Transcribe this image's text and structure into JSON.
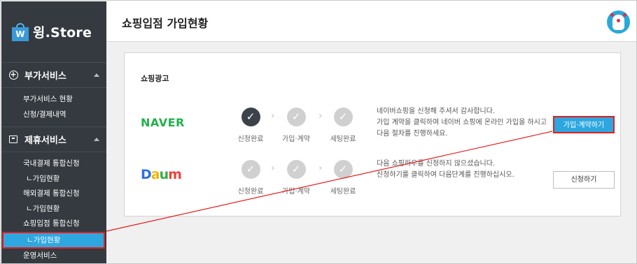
{
  "sidebar": {
    "logo_mark": "W",
    "logo_text": "윙.Store",
    "sections": [
      {
        "title": "부가서비스",
        "icon": "plus-circle-icon",
        "items": [
          "부가서비스 현황",
          "신청/결제내역"
        ]
      },
      {
        "title": "제휴서비스",
        "icon": "box-icon",
        "items": [
          "국내결제 통합신청",
          "ㄴ가입현황",
          "해외결제 통합신청",
          "ㄴ가입현황",
          "쇼핑입점 통합신청",
          "ㄴ가입현황",
          "운영서비스"
        ]
      }
    ]
  },
  "header": {
    "title": "쇼핑입점 가입현황"
  },
  "card": {
    "title": "쇼핑광고",
    "rows": [
      {
        "logo": "NAVER",
        "steps": [
          "신청완료",
          "가입·계약",
          "세팅완료"
        ],
        "desc_line1": "네이버쇼핑을 신청해 주셔서 감사합니다.",
        "desc_line2": "가입 계약을 클릭하여 네이버 쇼핑에 온라인 가입을 하시고 다음 절차를 진행하세요.",
        "button": "가입·계약하기"
      },
      {
        "logo_parts": [
          "D",
          "a",
          "u",
          "m"
        ],
        "steps": [
          "신청완료",
          "가입·계약",
          "세팅완료"
        ],
        "desc_line1": "다음 쇼핑하우를 신청하지 않으셨습니다.",
        "desc_line2": "신청하기를 클릭하여 다음단계를 진행하십시오.",
        "button": "신청하기"
      }
    ]
  },
  "colors": {
    "sidebar_bg": "#343a40",
    "accent_blue": "#2ea7e0",
    "highlight_red": "#e41f1f",
    "naver_green": "#22b14c"
  }
}
